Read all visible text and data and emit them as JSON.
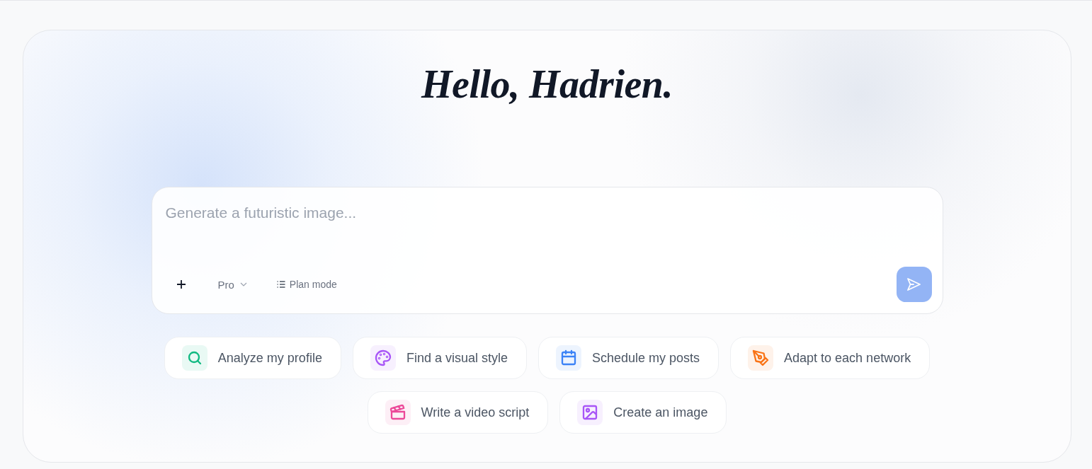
{
  "greeting": "Hello, Hadrien.",
  "composer": {
    "placeholder": "Generate a futuristic image...",
    "model": {
      "label": "Pro"
    },
    "plan_mode": {
      "label": "Plan mode"
    },
    "send": {
      "disabled": true
    }
  },
  "suggestions": [
    {
      "label": "Analyze my profile",
      "color": "#10b981"
    },
    {
      "label": "Find a visual style",
      "color": "#a855f7"
    },
    {
      "label": "Schedule my posts",
      "color": "#3b82f6"
    },
    {
      "label": "Adapt to each network",
      "color": "#f97316"
    },
    {
      "label": "Write a video script",
      "color": "#ec4899"
    },
    {
      "label": "Create an image",
      "color": "#a855f7"
    }
  ]
}
